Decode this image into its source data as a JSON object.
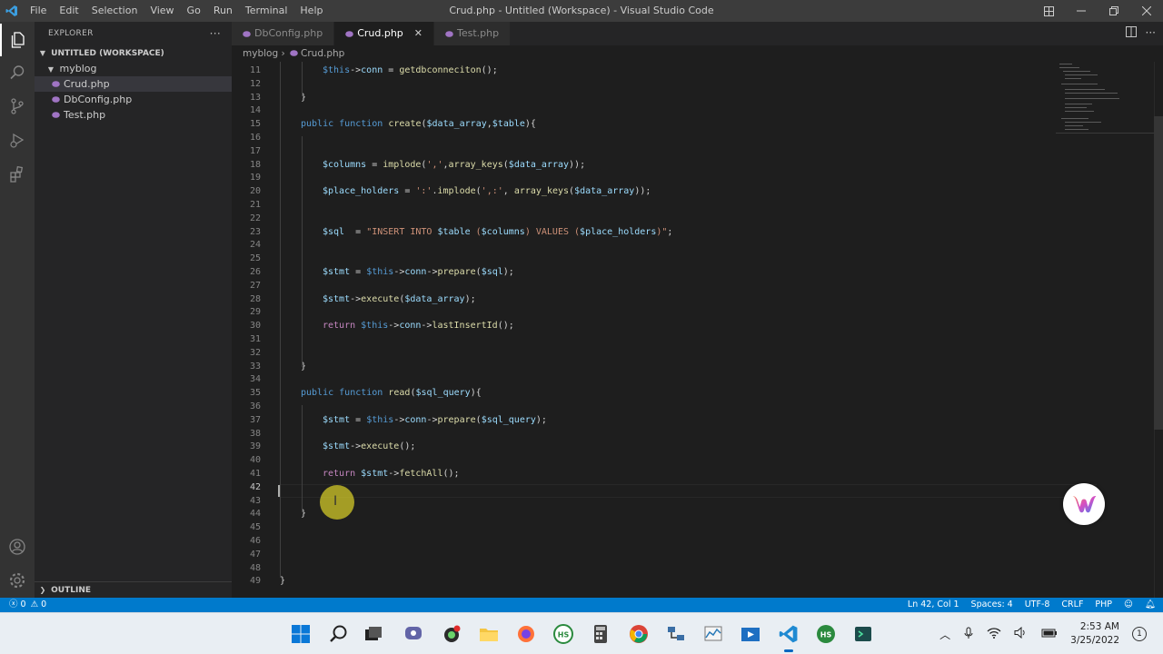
{
  "titlebar": {
    "title": "Crud.php - Untitled (Workspace) - Visual Studio Code",
    "menu": [
      "File",
      "Edit",
      "Selection",
      "View",
      "Go",
      "Run",
      "Terminal",
      "Help"
    ]
  },
  "sidebar": {
    "header": "EXPLORER",
    "workspace": "UNTITLED (WORKSPACE)",
    "folder": "myblog",
    "files": [
      "Crud.php",
      "DbConfig.php",
      "Test.php"
    ],
    "selected_file": "Crud.php",
    "outline": "OUTLINE"
  },
  "tabs": [
    {
      "label": "DbConfig.php",
      "active": false
    },
    {
      "label": "Crud.php",
      "active": true
    },
    {
      "label": "Test.php",
      "active": false
    }
  ],
  "breadcrumb": {
    "folder": "myblog",
    "file": "Crud.php"
  },
  "editor": {
    "lines": [
      {
        "n": "11",
        "code": "$this->conn = getdbconneciton();"
      },
      {
        "n": "12",
        "code": ""
      },
      {
        "n": "13",
        "code": "}"
      },
      {
        "n": "14",
        "code": ""
      },
      {
        "n": "15",
        "code": "public function create($data_array,$table){"
      },
      {
        "n": "16",
        "code": ""
      },
      {
        "n": "17",
        "code": ""
      },
      {
        "n": "18",
        "code": "$columns = implode(',',array_keys($data_array));"
      },
      {
        "n": "19",
        "code": ""
      },
      {
        "n": "20",
        "code": "$place_holders = ':'.implode(',:', array_keys($data_array));"
      },
      {
        "n": "21",
        "code": ""
      },
      {
        "n": "22",
        "code": ""
      },
      {
        "n": "23",
        "code": "$sql  = \"INSERT INTO $table ($columns) VALUES ($place_holders)\";"
      },
      {
        "n": "24",
        "code": ""
      },
      {
        "n": "25",
        "code": ""
      },
      {
        "n": "26",
        "code": "$stmt = $this->conn->prepare($sql);"
      },
      {
        "n": "27",
        "code": ""
      },
      {
        "n": "28",
        "code": "$stmt->execute($data_array);"
      },
      {
        "n": "29",
        "code": ""
      },
      {
        "n": "30",
        "code": "return $this->conn->lastInsertId();"
      },
      {
        "n": "31",
        "code": ""
      },
      {
        "n": "32",
        "code": ""
      },
      {
        "n": "33",
        "code": "}"
      },
      {
        "n": "34",
        "code": ""
      },
      {
        "n": "35",
        "code": "public function read($sql_query){"
      },
      {
        "n": "36",
        "code": ""
      },
      {
        "n": "37",
        "code": "$stmt = $this->conn->prepare($sql_query);"
      },
      {
        "n": "38",
        "code": ""
      },
      {
        "n": "39",
        "code": "$stmt->execute();"
      },
      {
        "n": "40",
        "code": ""
      },
      {
        "n": "41",
        "code": "return $stmt->fetchAll();"
      },
      {
        "n": "42",
        "code": ""
      },
      {
        "n": "43",
        "code": ""
      },
      {
        "n": "44",
        "code": "}"
      },
      {
        "n": "45",
        "code": ""
      },
      {
        "n": "46",
        "code": ""
      },
      {
        "n": "47",
        "code": ""
      },
      {
        "n": "48",
        "code": ""
      },
      {
        "n": "49",
        "code": "}"
      }
    ]
  },
  "statusbar": {
    "errors": "0",
    "warnings": "0",
    "position": "Ln 42, Col 1",
    "spaces": "Spaces: 4",
    "encoding": "UTF-8",
    "eol": "CRLF",
    "language": "PHP"
  },
  "taskbar": {
    "time": "2:53 AM",
    "date": "3/25/2022",
    "notifications": "1",
    "hs_label": "HS"
  },
  "colors": {
    "statusbar": "#007acc",
    "keyword": "#569cd6",
    "control": "#c586c0",
    "variable": "#9cdcfe",
    "function": "#dcdcaa",
    "string": "#ce9178"
  }
}
